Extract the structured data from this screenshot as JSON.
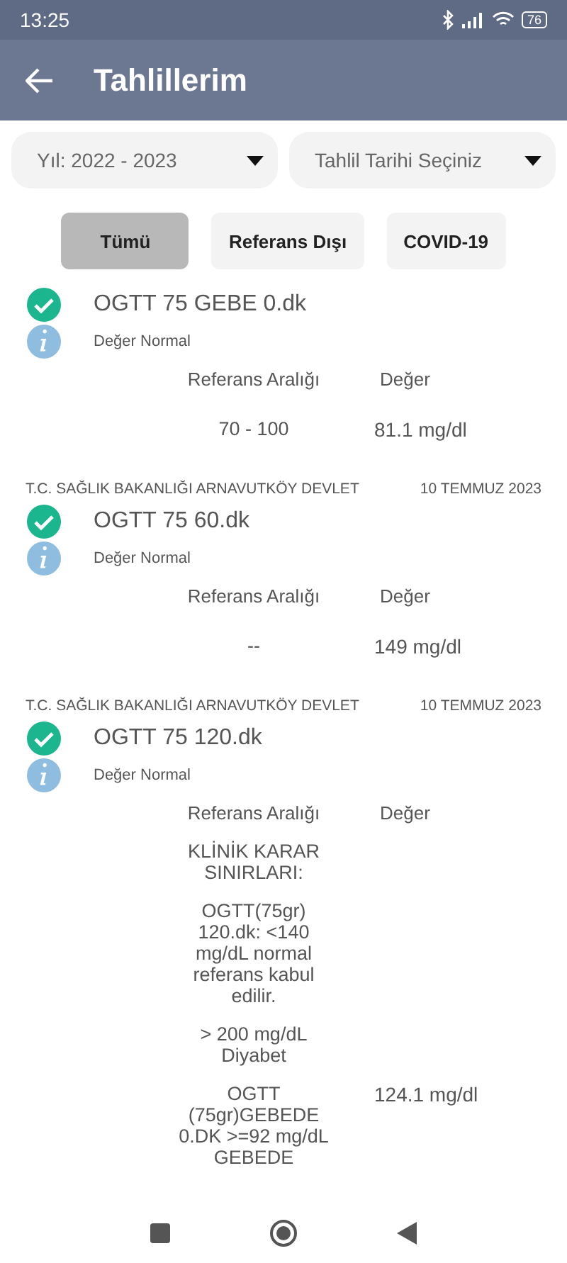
{
  "status_bar": {
    "time": "13:25",
    "battery": "76"
  },
  "header": {
    "title": "Tahlillerim"
  },
  "filters": [
    {
      "label": "Yıl: 2022 - 2023"
    },
    {
      "label": "Tahlil Tarihi Seçiniz"
    }
  ],
  "tabs": [
    {
      "label": "Tümü",
      "selected": true
    },
    {
      "label": "Referans Dışı",
      "selected": false
    },
    {
      "label": "COVID-19",
      "selected": false
    }
  ],
  "results": [
    {
      "name": "OGTT 75 GEBE 0.dk",
      "status": "Değer Normal",
      "normal": true,
      "range_label": "Referans Aralığı",
      "value_label": "Değer",
      "range": [
        "70 - 100"
      ],
      "value": "81.1 mg/dl"
    },
    {
      "hospital": "T.C. SAĞLIK BAKANLIĞI ARNAVUTKÖY DEVLET",
      "date": "10 TEMMUZ 2023",
      "name": "OGTT 75 60.dk",
      "status": "Değer Normal",
      "normal": true,
      "range_label": "Referans Aralığı",
      "value_label": "Değer",
      "range": [
        "--"
      ],
      "value": "149 mg/dl"
    },
    {
      "hospital": "T.C. SAĞLIK BAKANLIĞI ARNAVUTKÖY DEVLET",
      "date": "10 TEMMUZ 2023",
      "name": "OGTT 75 120.dk",
      "status": "Değer Normal",
      "normal": true,
      "range_label": "Referans Aralığı",
      "value_label": "Değer",
      "range": [
        "KLİNİK KARAR SINIRLARI:",
        "OGTT(75gr) 120.dk: <140 mg/dL normal referans kabul edilir.",
        "> 200 mg/dL Diyabet",
        "OGTT (75gr)GEBEDE 0.DK  >=92 mg/dL GEBEDE"
      ],
      "value": "124.1 mg/dl"
    }
  ]
}
